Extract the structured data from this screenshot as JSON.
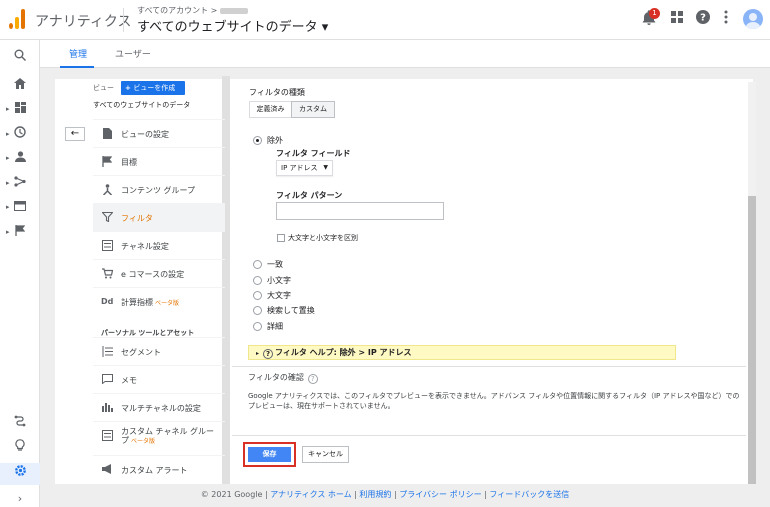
{
  "header": {
    "app_name": "アナリティクス",
    "account_breadcrumb": "すべてのアカウント >",
    "property_title": "すべてのウェブサイトのデータ ▾",
    "notification_count": "1",
    "icons": [
      "notifications-icon",
      "apps-grid-icon",
      "help-icon",
      "more-vert-icon",
      "avatar"
    ]
  },
  "tabs": [
    {
      "label": "管理",
      "active": true
    },
    {
      "label": "ユーザー",
      "active": false
    }
  ],
  "rail": {
    "icons": [
      "search-icon",
      "home-icon",
      "customization-icon",
      "realtime-icon",
      "audience-icon",
      "acquisition-icon",
      "behavior-icon",
      "conversions-icon",
      "attribution-icon",
      "discover-icon",
      "admin-gear-icon",
      "expand-icon"
    ]
  },
  "view_column": {
    "label": "ビュー",
    "create_button": "ビューを作成",
    "view_name": "すべてのウェブサイトのデータ",
    "items": [
      {
        "label": "ビューの設定",
        "icon": "document-icon"
      },
      {
        "label": "目標",
        "icon": "flag-icon"
      },
      {
        "label": "コンテンツ グループ",
        "icon": "grouping-icon"
      },
      {
        "label": "フィルタ",
        "icon": "filter-icon",
        "selected": true
      },
      {
        "label": "チャネル設定",
        "icon": "channel-icon"
      },
      {
        "label": "e コマースの設定",
        "icon": "cart-icon"
      },
      {
        "label": "計算指標",
        "icon": "dd-icon",
        "beta": "ベータ版"
      }
    ],
    "section_title": "パーソナル ツールとアセット",
    "personal_items": [
      {
        "label": "セグメント",
        "icon": "segment-icon"
      },
      {
        "label": "メモ",
        "icon": "memo-icon"
      },
      {
        "label": "マルチチャネルの設定",
        "icon": "bar-chart-icon"
      },
      {
        "label": "カスタム チャネル グループ",
        "icon": "custom-channel-icon",
        "beta": "ベータ版"
      },
      {
        "label": "カスタム アラート",
        "icon": "megaphone-icon"
      }
    ]
  },
  "filter": {
    "type_title": "フィルタの種類",
    "type_tabs": [
      "定義済み",
      "カスタム"
    ],
    "active_type": "カスタム",
    "exclude_label": "除外",
    "field_label": "フィルタ フィールド",
    "field_value": "IP アドレス",
    "pattern_label": "フィルタ パターン",
    "pattern_value": "",
    "case_label": "大文字と小文字を区別",
    "other_options": [
      "一致",
      "小文字",
      "大文字",
      "検索して置換",
      "詳細"
    ],
    "help_text": "フィルタ ヘルプ: 除外 > IP アドレス",
    "verify_title": "フィルタの確認",
    "verify_text": "Google アナリティクスでは、このフィルタでプレビューを表示できません。アドバンス フィルタや位置情報に関するフィルタ（IP アドレスや国など）でのプレビューは、現在サポートされていません。",
    "save_label": "保存",
    "cancel_label": "キャンセル"
  },
  "footer": {
    "copyright": "© 2021 Google",
    "links": [
      "アナリティクス ホーム",
      "利用規約",
      "プライバシー ポリシー",
      "フィードバックを送信"
    ]
  },
  "colors": {
    "accent": "#1a73e8",
    "brand": "#e37400",
    "highlight": "#d93025"
  }
}
